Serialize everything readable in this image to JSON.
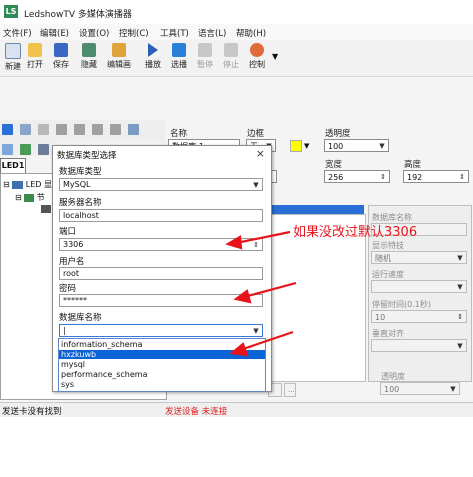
{
  "app": {
    "logo": "LS",
    "title": "LedshowTV 多媒体演播器"
  },
  "menu": [
    "文件(F)",
    "编辑(E)",
    "设置(O)",
    "控制(C)",
    "工具(T)",
    "语言(L)",
    "帮助(H)"
  ],
  "toolbar": {
    "buttons": [
      {
        "label": "新建",
        "icon": "new-file-icon",
        "color": "#d8e3f0"
      },
      {
        "label": "打开",
        "icon": "folder-open-icon",
        "color": "#f2c24d"
      },
      {
        "label": "保存",
        "icon": "save-icon",
        "color": "#3a66c4"
      },
      {
        "label": "隐藏",
        "icon": "hide-icon",
        "color": "#4c8c6c"
      },
      {
        "label": "编辑画",
        "icon": "pencil-icon",
        "color": "#e0a33a"
      },
      {
        "label": "播放",
        "icon": "play-icon",
        "color": "#2a5fb8"
      },
      {
        "label": "选播",
        "icon": "select-play-icon",
        "color": "#2a7fd8"
      },
      {
        "label": "暂停",
        "icon": "pause-icon",
        "color": "#b0b0b0"
      },
      {
        "label": "停止",
        "icon": "stop-icon",
        "color": "#b0b0b0"
      },
      {
        "label": "控制",
        "icon": "control-icon",
        "color": "#e06a3a"
      }
    ]
  },
  "left_panel": {
    "tab": "LED1",
    "tree": [
      {
        "label": "LED 显"
      },
      {
        "label": "节"
      }
    ]
  },
  "properties": {
    "name_label": "名称",
    "name_value": "数据库-1",
    "border_label": "边框",
    "border_value": "无",
    "transparency_label": "透明度",
    "transparency_value": "100",
    "width_label": "宽度",
    "width_value": "256",
    "height_label": "高度",
    "height_value": "192",
    "border_color": "#ffff00"
  },
  "right_panel": {
    "db_name_label": "数据库名称",
    "display_effect_label": "显示特技",
    "display_effect_value": "随机",
    "speed_label": "运行速度",
    "stay_time_label": "停留时间(0.1秒)",
    "stay_time_value": "10",
    "align_label": "垂直对齐",
    "bottom_transparency_label": "透明度",
    "bottom_transparency_value": "100"
  },
  "dialog": {
    "title": "数据库类型选择",
    "close": "×",
    "db_type_label": "数据库类型",
    "db_type_value": "MySQL",
    "server_label": "服务器名称",
    "server_value": "localhost",
    "port_label": "端口",
    "port_value": "3306",
    "user_label": "用户名",
    "user_value": "root",
    "password_label": "密码",
    "password_value": "******",
    "dbname_label": "数据库名称",
    "dbname_value": "|",
    "dropdown_options": [
      "information_schema",
      "hxzkuwb",
      "mysql",
      "performance_schema",
      "sys"
    ],
    "selected_option": "hxzkuwb"
  },
  "annotation": {
    "text": "如果没改过默认3306",
    "color": "#e8141b"
  },
  "status": {
    "left": "发送卡没有找到",
    "right": "发送设备 未连接"
  }
}
